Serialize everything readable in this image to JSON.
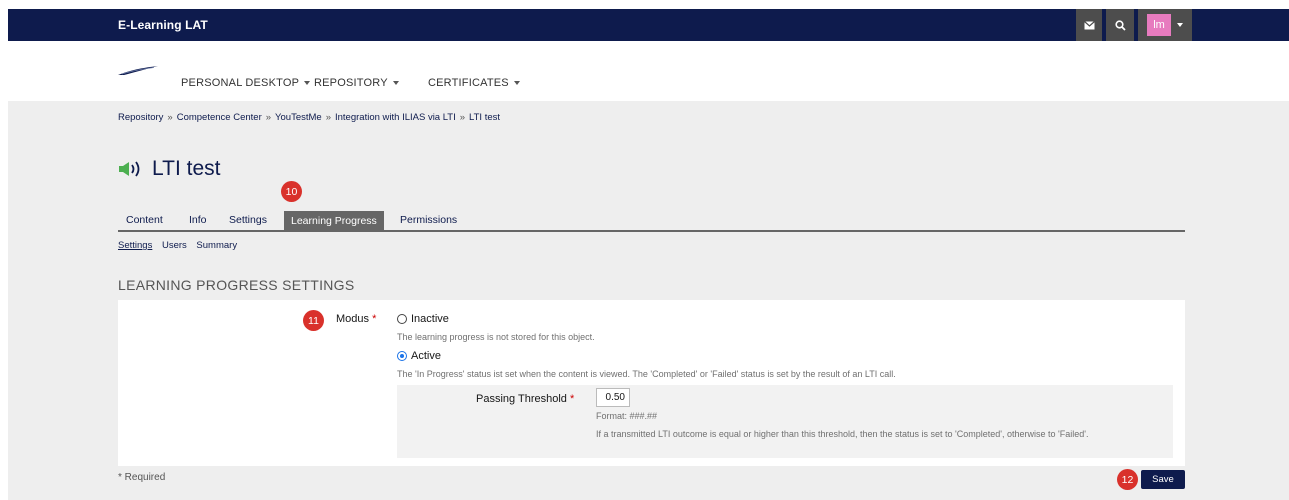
{
  "topbar": {
    "app_title": "E-Learning LAT",
    "avatar_initials": "lm",
    "icons": [
      "mail-icon",
      "search-icon",
      "chevron-down-icon"
    ]
  },
  "mainmenu": {
    "items": [
      {
        "label": "PERSONAL DESKTOP"
      },
      {
        "label": "REPOSITORY"
      },
      {
        "label": "CERTIFICATES"
      }
    ]
  },
  "breadcrumb": [
    "Repository",
    "Competence Center",
    "YouTestMe",
    "Integration with ILIAS via LTI",
    "LTI test"
  ],
  "breadcrumb_sep": "»",
  "page": {
    "title": "LTI test",
    "title_icon": "lti-sound-icon"
  },
  "tabs": [
    {
      "label": "Content"
    },
    {
      "label": "Info"
    },
    {
      "label": "Settings"
    },
    {
      "label": "Learning Progress"
    },
    {
      "label": "Permissions"
    }
  ],
  "subtabs": [
    {
      "label": "Settings"
    },
    {
      "label": "Users"
    },
    {
      "label": "Summary"
    }
  ],
  "section_title": "LEARNING PROGRESS SETTINGS",
  "form": {
    "modus_label": "Modus",
    "required_mark": "*",
    "inactive_label": "Inactive",
    "inactive_help": "The learning progress is not stored for this object.",
    "active_label": "Active",
    "active_help": "The 'In Progress' status ist set when the content is viewed. The 'Completed' or 'Failed' status is set by the result of an LTI call.",
    "selected": "Active",
    "threshold_label": "Passing Threshold",
    "threshold_value": "0.50",
    "threshold_format": "Format: ###.##",
    "threshold_help": "If a transmitted LTI outcome is equal or higher than this threshold, then the status is set to 'Completed', otherwise to 'Failed'.",
    "required_note": "* Required",
    "save_label": "Save"
  },
  "annotations": {
    "badge_10": "10",
    "badge_11": "11",
    "badge_12": "12",
    "badge_color": "#d9312b"
  },
  "colors": {
    "brand_navy": "#0e1b4d",
    "avatar_pink": "#e77bbf",
    "tab_active": "#666666",
    "body_gray": "#eeeeee"
  }
}
